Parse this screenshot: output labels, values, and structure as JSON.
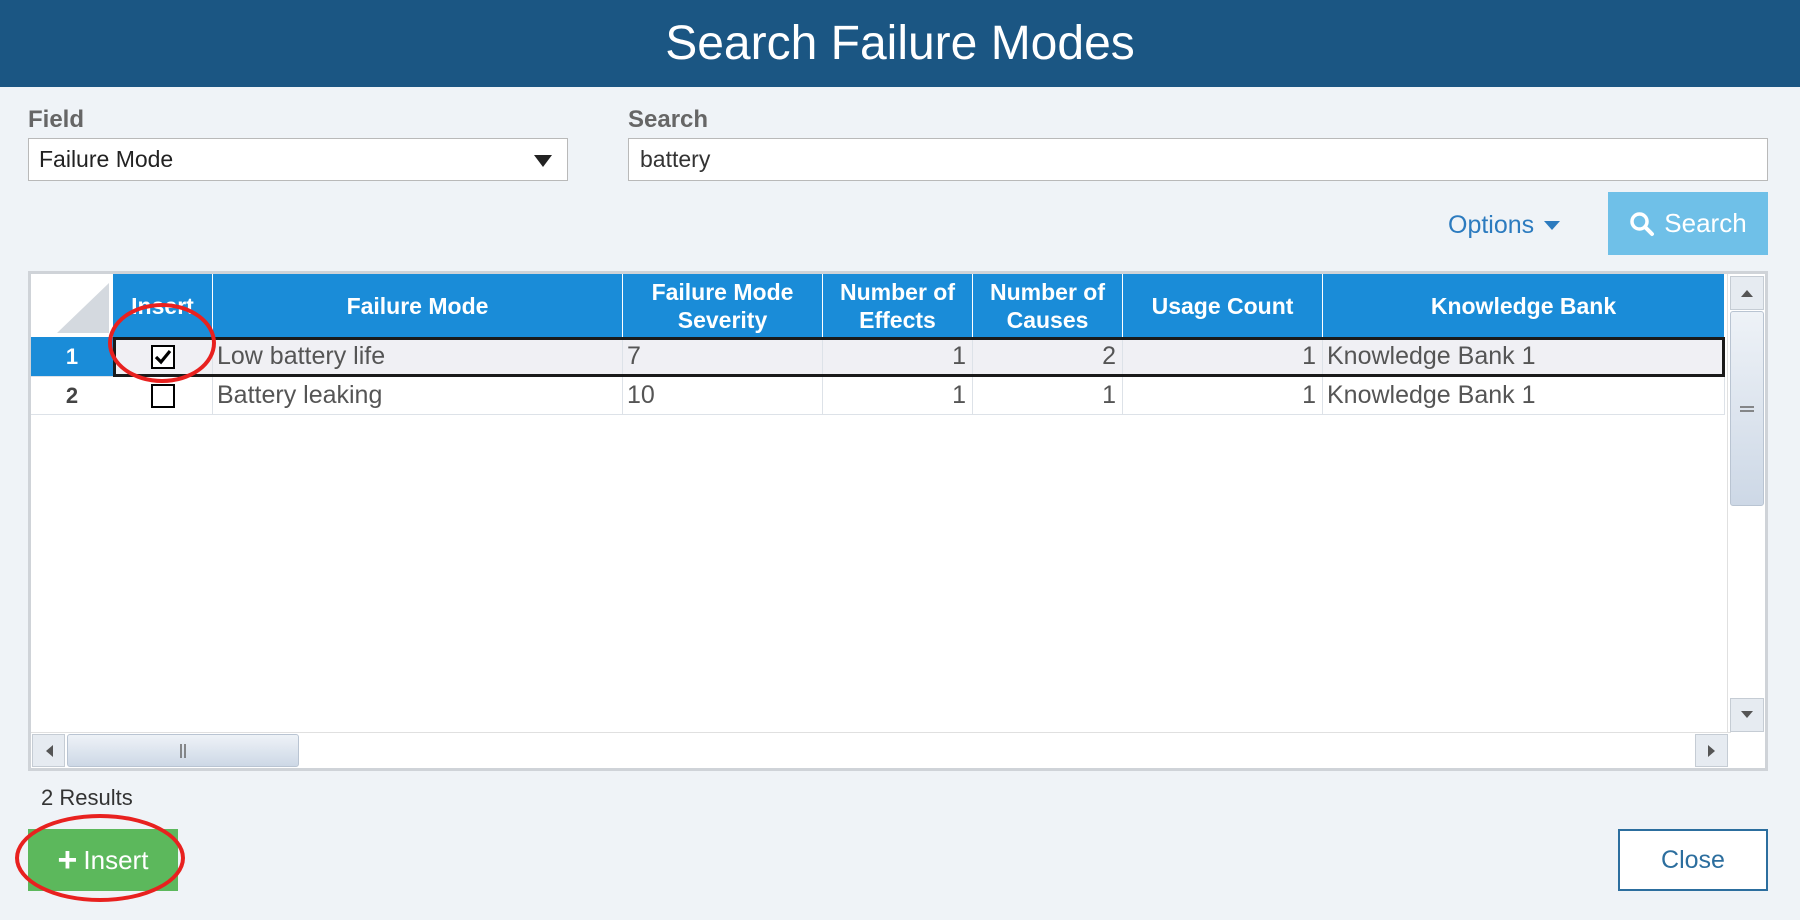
{
  "dialog": {
    "title": "Search Failure Modes"
  },
  "field": {
    "label": "Field",
    "selected": "Failure Mode"
  },
  "search": {
    "label": "Search",
    "value": "battery"
  },
  "toolbar": {
    "options_label": "Options",
    "search_label": "Search"
  },
  "grid": {
    "headers": {
      "insert": "Insert",
      "failure_mode": "Failure Mode",
      "severity": "Failure Mode Severity",
      "effects": "Number of Effects",
      "causes": "Number of Causes",
      "usage": "Usage Count",
      "knowledge_bank": "Knowledge Bank"
    },
    "rows": [
      {
        "num": "1",
        "checked": true,
        "failure_mode": "Low battery life",
        "severity": "7",
        "effects": "1",
        "causes": "2",
        "usage": "1",
        "knowledge_bank": "Knowledge Bank 1"
      },
      {
        "num": "2",
        "checked": false,
        "failure_mode": "Battery leaking",
        "severity": "10",
        "effects": "1",
        "causes": "1",
        "usage": "1",
        "knowledge_bank": "Knowledge Bank 1"
      }
    ]
  },
  "footer": {
    "results": "2 Results",
    "insert_label": "Insert",
    "close_label": "Close"
  },
  "colors": {
    "title_bar": "#1b5683",
    "header": "#1a8cd8",
    "insert_button": "#5cb85c",
    "annotation": "#e8211f"
  }
}
